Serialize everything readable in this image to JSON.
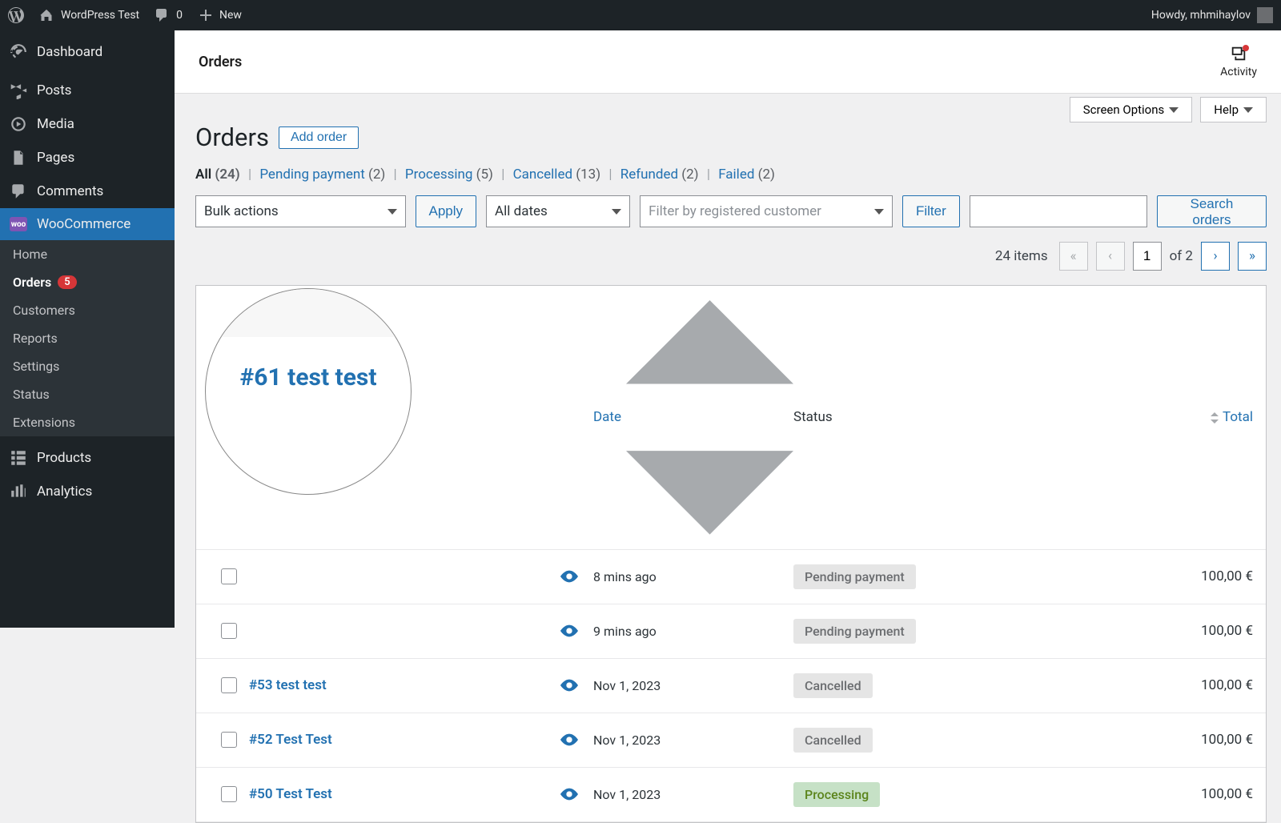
{
  "adminbar": {
    "site_name": "WordPress Test",
    "comments_count": "0",
    "new_label": "New",
    "howdy": "Howdy, mhmihaylov"
  },
  "sidebar": {
    "dashboard": "Dashboard",
    "posts": "Posts",
    "media": "Media",
    "pages": "Pages",
    "comments": "Comments",
    "woocommerce": "WooCommerce",
    "woo_submenu": {
      "home": "Home",
      "orders": "Orders",
      "orders_badge": "5",
      "customers": "Customers",
      "reports": "Reports",
      "settings": "Settings",
      "status": "Status",
      "extensions": "Extensions"
    },
    "products": "Products",
    "analytics": "Analytics"
  },
  "header": {
    "title": "Orders",
    "activity": "Activity"
  },
  "toolbar": {
    "screen_options": "Screen Options",
    "help": "Help"
  },
  "page": {
    "heading": "Orders",
    "add_order": "Add order"
  },
  "filters": {
    "all": "All",
    "all_count": "(24)",
    "pending": "Pending payment",
    "pending_count": "(2)",
    "processing": "Processing",
    "processing_count": "(5)",
    "cancelled": "Cancelled",
    "cancelled_count": "(13)",
    "refunded": "Refunded",
    "refunded_count": "(2)",
    "failed": "Failed",
    "failed_count": "(2)"
  },
  "controls": {
    "bulk_actions": "Bulk actions",
    "apply": "Apply",
    "all_dates": "All dates",
    "customer_filter": "Filter by registered customer",
    "filter": "Filter",
    "search_orders": "Search orders"
  },
  "pagination": {
    "items": "24 items",
    "current": "1",
    "of": "of 2"
  },
  "table": {
    "col_date": "Date",
    "col_status": "Status",
    "col_total": "Total"
  },
  "orders": [
    {
      "name": "",
      "date": "8 mins ago",
      "status": "Pending payment",
      "status_class": "pending",
      "total": "100,00 €"
    },
    {
      "name": "",
      "date": "9 mins ago",
      "status": "Pending payment",
      "status_class": "pending",
      "total": "100,00 €"
    },
    {
      "name": "#53 test test",
      "date": "Nov 1, 2023",
      "status": "Cancelled",
      "status_class": "cancelled",
      "total": "100,00 €"
    },
    {
      "name": "#52 Test Test",
      "date": "Nov 1, 2023",
      "status": "Cancelled",
      "status_class": "cancelled",
      "total": "100,00 €"
    },
    {
      "name": "#50 Test Test",
      "date": "Nov 1, 2023",
      "status": "Processing",
      "status_class": "processing",
      "total": "100,00 €"
    }
  ],
  "magnifier": {
    "text": "#61 test test"
  }
}
